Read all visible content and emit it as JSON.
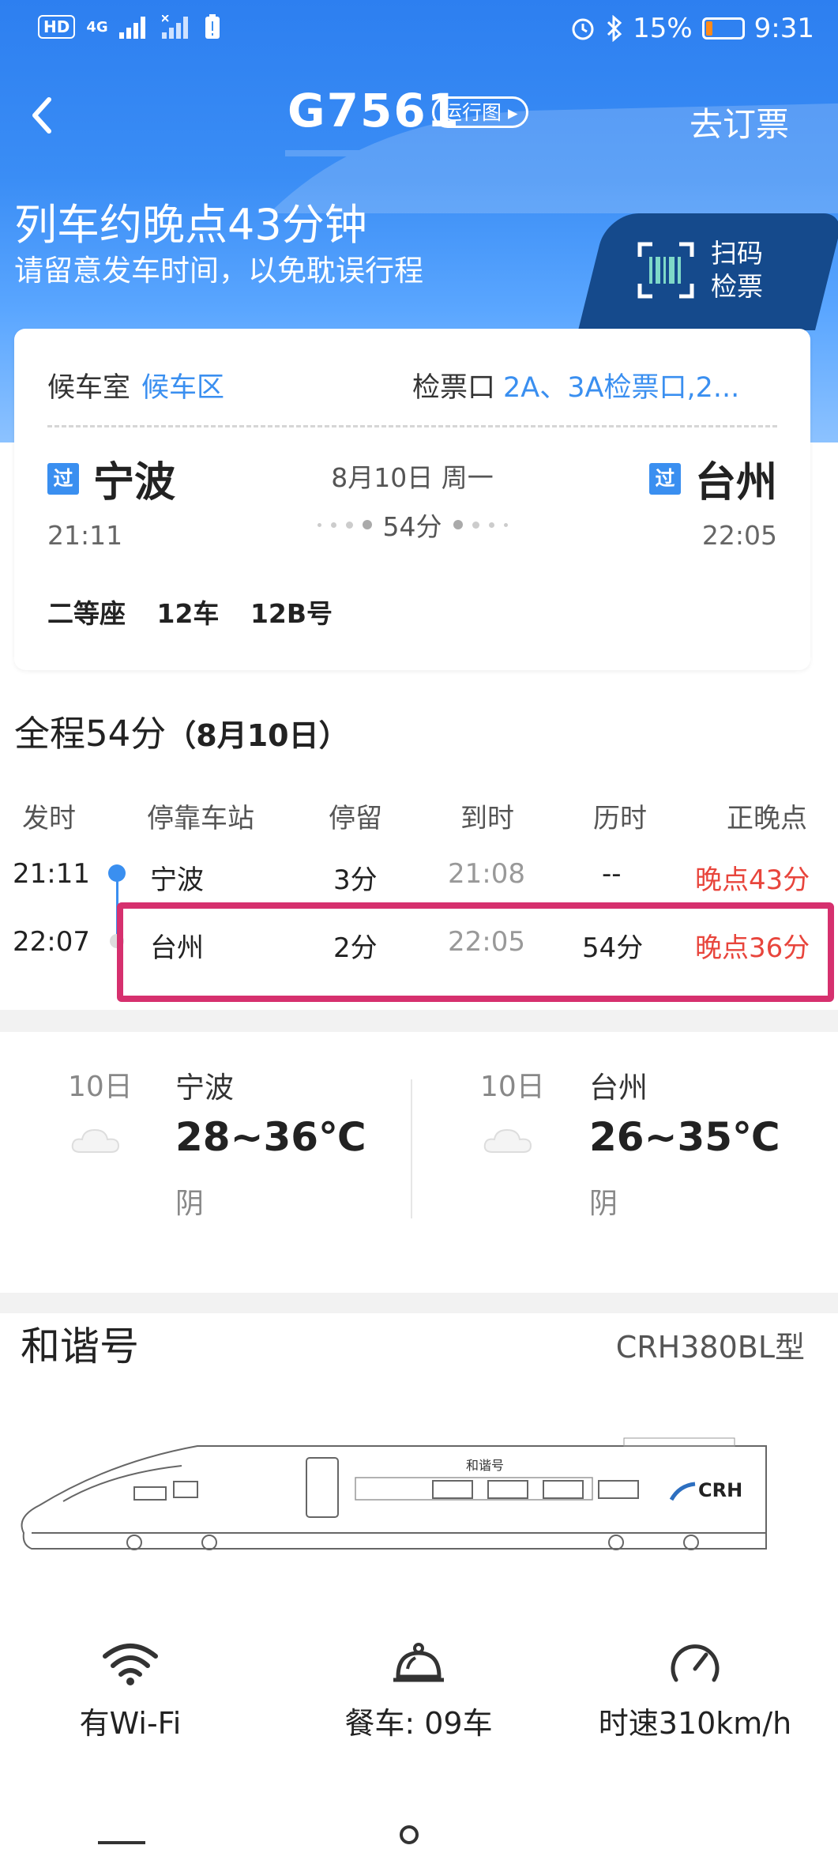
{
  "statusbar": {
    "left_icons": [
      "HD",
      "4G",
      "signal-icon",
      "signal-x-icon",
      "battery-alert-icon"
    ],
    "battery_percent": "15%",
    "time": "9:31"
  },
  "nav": {
    "title": "G7561",
    "map_label": "运行图",
    "order_label": "去订票"
  },
  "notice": {
    "headline": "列车约晚点43分钟",
    "subline": "请留意发车时间，以免耽误行程"
  },
  "scan": {
    "line1": "扫码",
    "line2": "检票"
  },
  "ticket": {
    "waiting_label": "候车室",
    "waiting_value": "候车区",
    "gate_label": "检票口",
    "gate_value": "2A、3A检票口,2...",
    "pass_badge": "过",
    "from_station": "宁波",
    "from_time": "21:11",
    "to_station": "台州",
    "to_time": "22:05",
    "date": "8月10日 周一",
    "duration": "54分",
    "seat_class": "二等座",
    "car": "12车",
    "seat_no": "12B号"
  },
  "schedule": {
    "total_label": "全程54分",
    "total_date": "（8月10日）",
    "headers": [
      "发时",
      "停靠车站",
      "停留",
      "到时",
      "历时",
      "正晚点"
    ],
    "rows": [
      {
        "depart": "21:11",
        "station": "宁波",
        "stop": "3分",
        "arrive": "21:08",
        "elapsed": "--",
        "status": "晚点43分"
      },
      {
        "depart": "22:07",
        "station": "台州",
        "stop": "2分",
        "arrive": "22:05",
        "elapsed": "54分",
        "status": "晚点36分"
      }
    ]
  },
  "weather": [
    {
      "day": "10日",
      "city": "宁波",
      "temp": "28~36℃",
      "desc": "阴",
      "icon": "cloud-icon"
    },
    {
      "day": "10日",
      "city": "台州",
      "temp": "26~35℃",
      "desc": "阴",
      "icon": "cloud-icon"
    }
  ],
  "train": {
    "brand": "和谐号",
    "model": "CRH380BL型",
    "body_brand": "和谐号",
    "logo": "CRH"
  },
  "features": [
    {
      "label": "有Wi-Fi",
      "icon": "wifi-icon"
    },
    {
      "label": "餐车: 09车",
      "icon": "dining-bell-icon"
    },
    {
      "label": "时速310km/h",
      "icon": "speedometer-icon"
    }
  ],
  "colors": {
    "primary": "#3a8ff0",
    "header_dark": "#154a8c",
    "delay_red": "#e8453c",
    "highlight": "#d6306e"
  }
}
